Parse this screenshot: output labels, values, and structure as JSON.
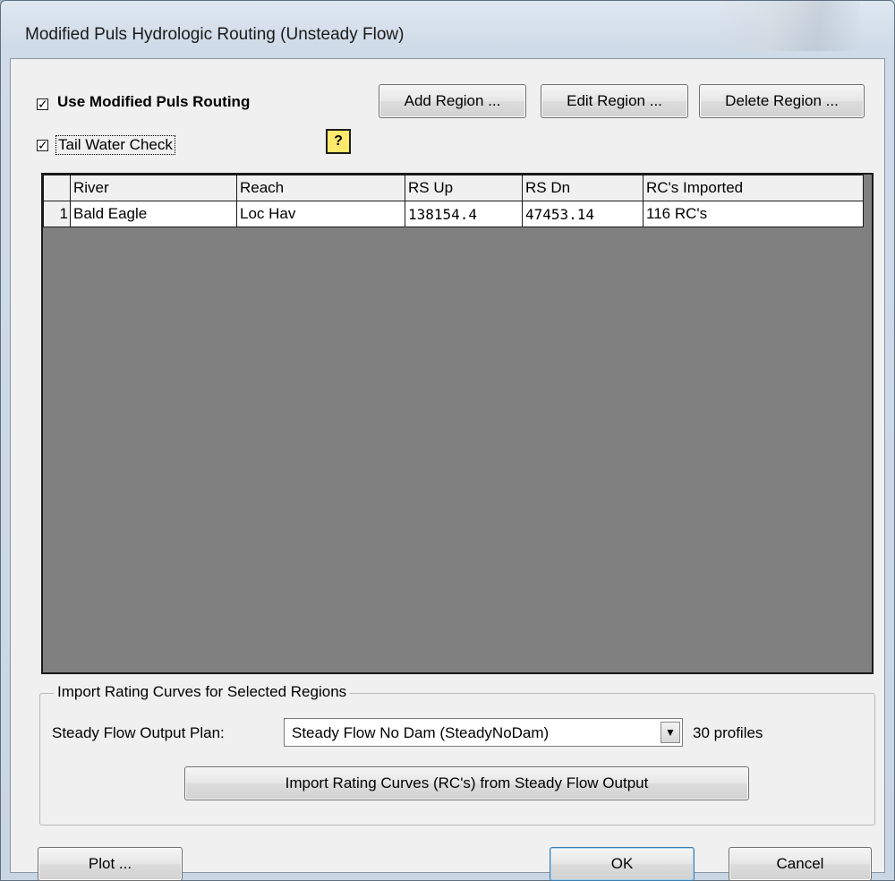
{
  "window": {
    "title": "Modified Puls Hydrologic Routing (Unsteady Flow)"
  },
  "options": {
    "use_modified_puls": {
      "label": "Use Modified Puls Routing",
      "checked": true
    },
    "tail_water_check": {
      "label": "Tail Water Check",
      "checked": true
    },
    "check_mark": "✓"
  },
  "toolbar": {
    "add_region": "Add Region ...",
    "edit_region": "Edit Region ...",
    "delete_region": "Delete Region ...",
    "help_icon": "?"
  },
  "table": {
    "columns": [
      "River",
      "Reach",
      "RS Up",
      "RS Dn",
      "RC's Imported"
    ],
    "rows": [
      {
        "num": "1",
        "river": "Bald Eagle",
        "reach": "Loc Hav",
        "rs_up": "138154.4",
        "rs_dn": "47453.14",
        "rc_imported": "116 RC's"
      }
    ]
  },
  "import_group": {
    "title": "Import Rating Curves for Selected Regions",
    "plan_label": "Steady Flow Output Plan:",
    "plan_value": "Steady Flow No Dam (SteadyNoDam)",
    "profiles": "30 profiles",
    "import_button": "Import Rating Curves (RC's) from Steady Flow Output",
    "dropdown_arrow": "▼"
  },
  "footer": {
    "plot": "Plot ...",
    "ok": "OK",
    "cancel": "Cancel"
  }
}
